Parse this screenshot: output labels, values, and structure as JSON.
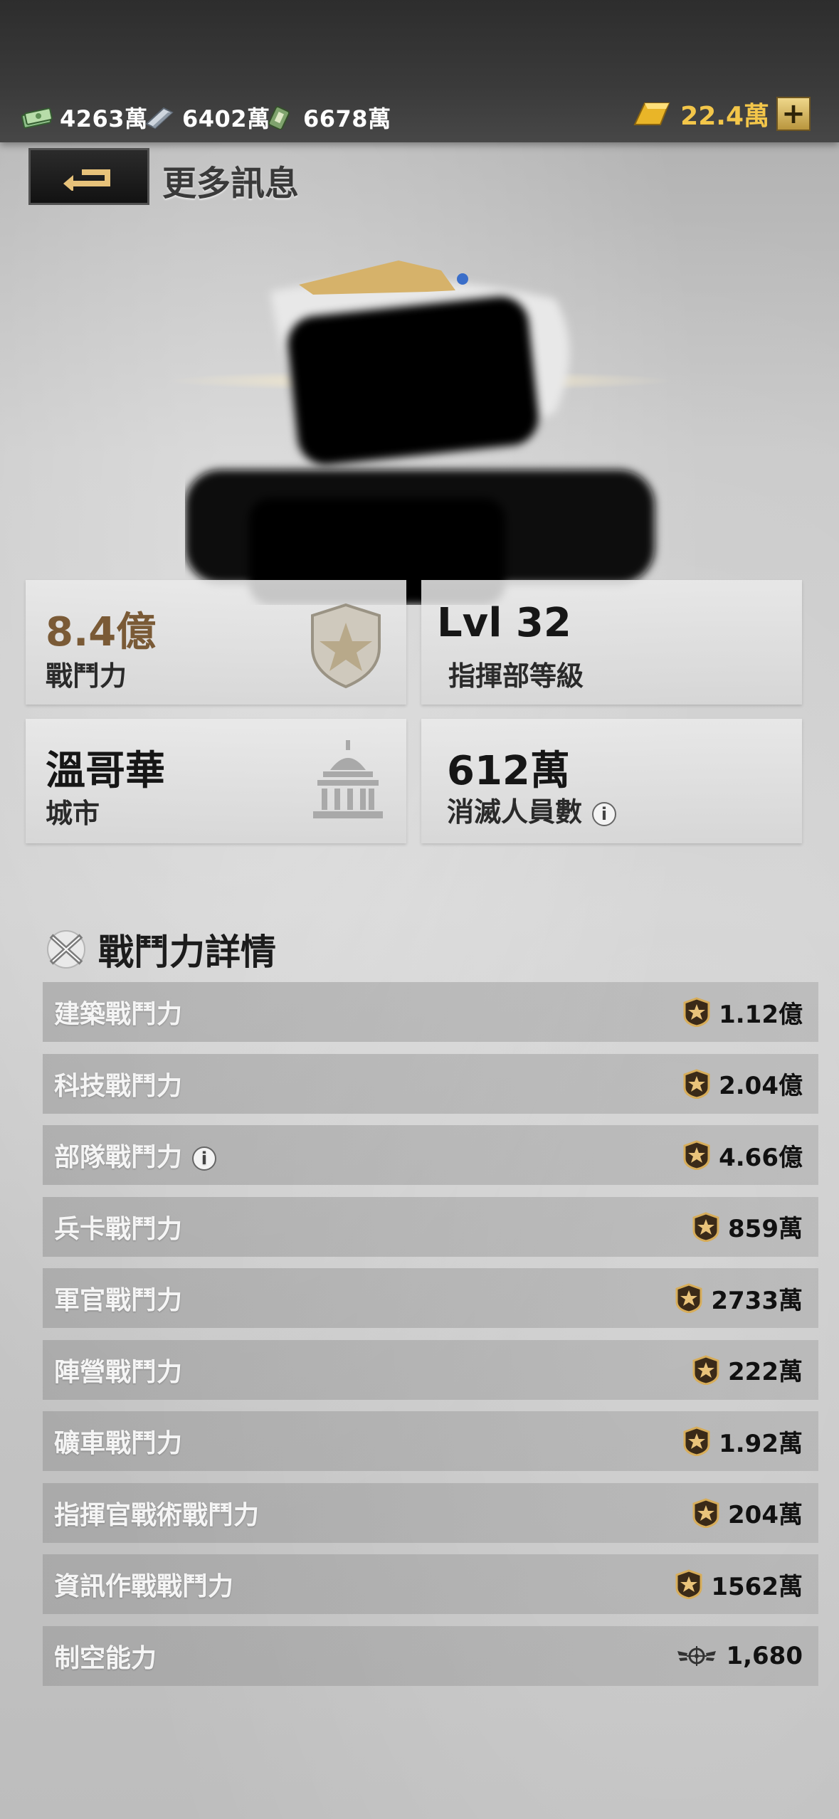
{
  "resources": [
    {
      "icon": "cash-stack-icon",
      "value": "4263萬"
    },
    {
      "icon": "steel-bar-icon",
      "value": "6402萬"
    },
    {
      "icon": "fuel-cell-icon",
      "value": "6678萬"
    }
  ],
  "gold": {
    "icon": "gold-bar-icon",
    "value": "22.4萬",
    "plus_label": "+"
  },
  "header": {
    "back_icon": "back-arrow-icon",
    "title": "更多訊息"
  },
  "stats": {
    "power": {
      "value": "8.4億",
      "label": "戰鬥力",
      "value_color": "#7a5a36"
    },
    "hq_level": {
      "value": "Lvl 32",
      "label": "指揮部等級"
    },
    "city": {
      "value": "溫哥華",
      "label": "城市"
    },
    "kills": {
      "value": "612萬",
      "label": "消滅人員數"
    }
  },
  "details": {
    "title": "戰鬥力詳情",
    "rows": [
      {
        "label": "建築戰鬥力",
        "value": "1.12億",
        "icon": "star-badge-icon",
        "info": false
      },
      {
        "label": "科技戰鬥力",
        "value": "2.04億",
        "icon": "star-badge-icon",
        "info": false
      },
      {
        "label": "部隊戰鬥力",
        "value": "4.66億",
        "icon": "star-badge-icon",
        "info": true
      },
      {
        "label": "兵卡戰鬥力",
        "value": "859萬",
        "icon": "star-badge-icon",
        "info": false
      },
      {
        "label": "軍官戰鬥力",
        "value": "2733萬",
        "icon": "star-badge-icon",
        "info": false
      },
      {
        "label": "陣營戰鬥力",
        "value": "222萬",
        "icon": "star-badge-icon",
        "info": false
      },
      {
        "label": "礦車戰鬥力",
        "value": "1.92萬",
        "icon": "star-badge-icon",
        "info": false
      },
      {
        "label": "指揮官戰術戰鬥力",
        "value": "204萬",
        "icon": "star-badge-icon",
        "info": false
      },
      {
        "label": "資訊作戰戰鬥力",
        "value": "1562萬",
        "icon": "star-badge-icon",
        "info": false
      },
      {
        "label": "制空能力",
        "value": "1,680",
        "icon": "air-wings-icon",
        "info": false
      }
    ]
  },
  "colors": {
    "gold": "#f3c64a",
    "power_value": "#7a5a36"
  }
}
